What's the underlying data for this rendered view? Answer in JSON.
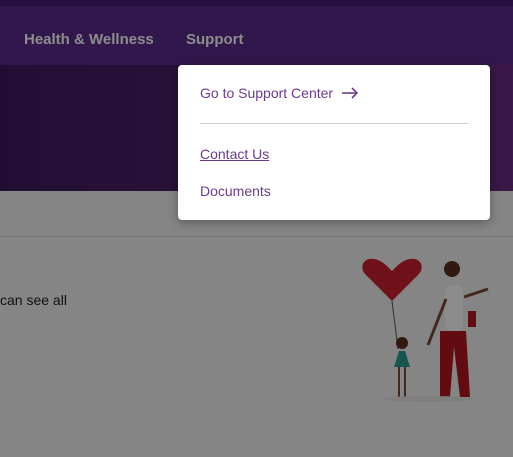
{
  "nav": {
    "items": [
      {
        "label": "Health & Wellness"
      },
      {
        "label": "Support"
      }
    ]
  },
  "content": {
    "partial_text": "can see all"
  },
  "dropdown": {
    "go_to_label": "Go to Support Center",
    "contact_label": "Contact Us",
    "documents_label": "Documents"
  },
  "colors": {
    "brand_purple": "#5b2a8c",
    "link_purple": "#6a3c8d",
    "heart_red": "#c9202f"
  },
  "icons": {
    "go_to_arrow": "arrow-right-icon"
  }
}
